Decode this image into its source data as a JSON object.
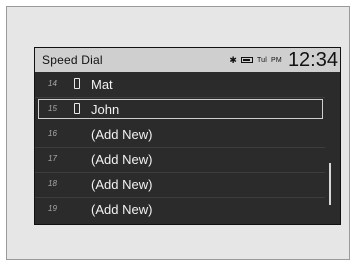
{
  "header": {
    "title": "Speed Dial",
    "status_icons": [
      "bluetooth-icon",
      "battery-icon",
      "signal-icon"
    ],
    "signal_text": "Tul",
    "ampm": "PM",
    "time": "12:34"
  },
  "list": {
    "items": [
      {
        "slot": "14",
        "has_phone_icon": true,
        "label": "Mat"
      },
      {
        "slot": "15",
        "has_phone_icon": true,
        "label": "John",
        "selected": true
      },
      {
        "slot": "16",
        "has_phone_icon": false,
        "label": "(Add New)"
      },
      {
        "slot": "17",
        "has_phone_icon": false,
        "label": "(Add New)"
      },
      {
        "slot": "18",
        "has_phone_icon": false,
        "label": "(Add New)"
      },
      {
        "slot": "19",
        "has_phone_icon": false,
        "label": "(Add New)"
      }
    ]
  },
  "colors": {
    "screen_bg": "#2b2b2b",
    "titlebar_bg": "#cfcfcf",
    "text": "#f2f2f2"
  }
}
